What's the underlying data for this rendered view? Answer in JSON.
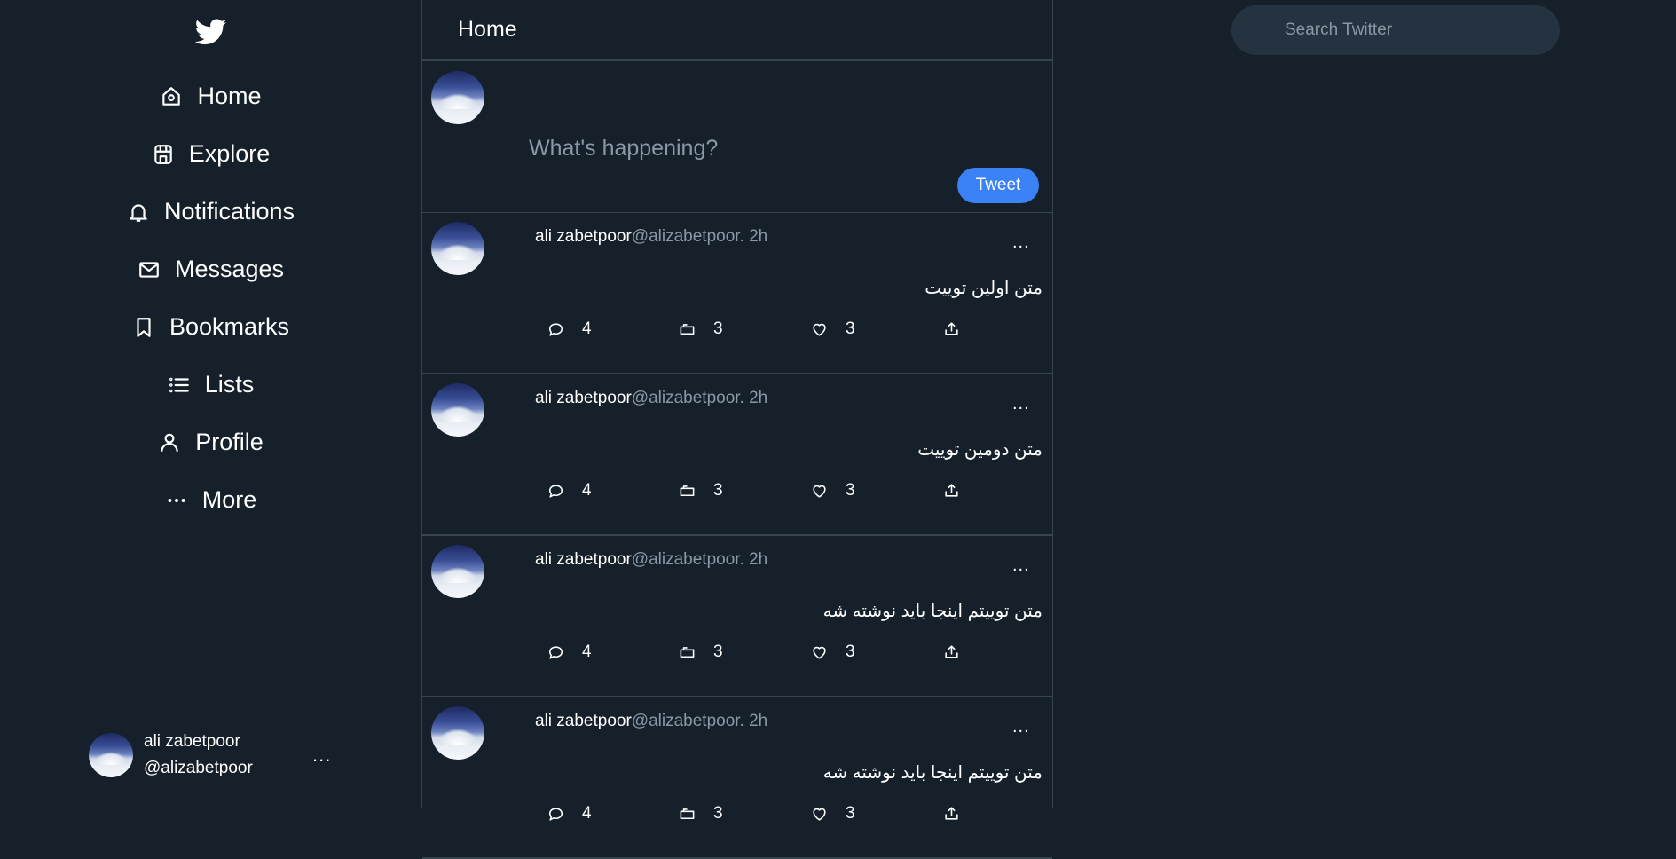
{
  "app": {
    "logo_icon": "twitter-bird-icon"
  },
  "nav": [
    {
      "label": "Home",
      "icon": "home-icon"
    },
    {
      "label": "Explore",
      "icon": "explore-icon"
    },
    {
      "label": "Notifications",
      "icon": "bell-icon"
    },
    {
      "label": "Messages",
      "icon": "mail-icon"
    },
    {
      "label": "Bookmarks",
      "icon": "bookmark-icon"
    },
    {
      "label": "Lists",
      "icon": "list-icon"
    },
    {
      "label": "Profile",
      "icon": "person-icon"
    },
    {
      "label": "More",
      "icon": "more-dots-icon"
    }
  ],
  "account": {
    "name": "ali zabetpoor",
    "handle": "@alizabetpoor",
    "more": "..."
  },
  "header": {
    "title": "Home"
  },
  "composer": {
    "placeholder": "What's happening?",
    "button": "Tweet"
  },
  "tweets": [
    {
      "name": "ali zabetpoor",
      "handle": "@alizabetpoor. 2h",
      "more": "...",
      "text": "متن اولین توییت",
      "replies": "4",
      "retweets": "3",
      "likes": "3"
    },
    {
      "name": "ali zabetpoor",
      "handle": "@alizabetpoor. 2h",
      "more": "...",
      "text": "متن دومین توییت",
      "replies": "4",
      "retweets": "3",
      "likes": "3"
    },
    {
      "name": "ali zabetpoor",
      "handle": "@alizabetpoor. 2h",
      "more": "...",
      "text": "متن توییتم اینجا باید نوشته شه",
      "replies": "4",
      "retweets": "3",
      "likes": "3"
    },
    {
      "name": "ali zabetpoor",
      "handle": "@alizabetpoor. 2h",
      "more": "...",
      "text": "متن توییتم اینجا باید نوشته شه",
      "replies": "4",
      "retweets": "3",
      "likes": "3"
    }
  ],
  "search": {
    "placeholder": "Search Twitter"
  },
  "colors": {
    "background": "#15202b",
    "border": "#38444d",
    "accent": "#3b82f6",
    "muted": "#8b98a5",
    "search_bg": "#253341"
  }
}
